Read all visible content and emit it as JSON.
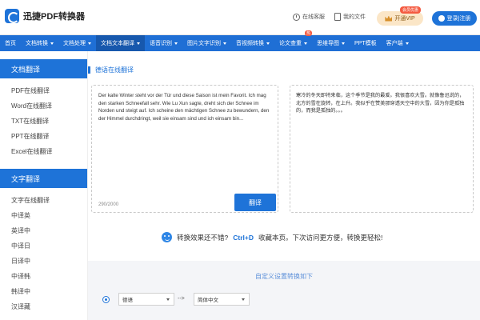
{
  "brand": {
    "name": "迅捷PDF转换器"
  },
  "topbar": {
    "online_service": "在线客服",
    "my_files": "我的文件",
    "vip": "开通VIP",
    "vip_badge": "会员优惠",
    "login": "登录|注册"
  },
  "nav": {
    "items": [
      {
        "label": "首页",
        "caret": false
      },
      {
        "label": "文档转换",
        "caret": true
      },
      {
        "label": "文档处理",
        "caret": true
      },
      {
        "label": "文档文本翻译",
        "caret": true,
        "active": true
      },
      {
        "label": "语音识别",
        "caret": true
      },
      {
        "label": "图片文字识别",
        "caret": true
      },
      {
        "label": "音视频转换",
        "caret": true
      },
      {
        "label": "论文查重",
        "caret": true,
        "badge": "热"
      },
      {
        "label": "思维导图",
        "caret": true
      },
      {
        "label": "PPT模板",
        "caret": false
      },
      {
        "label": "客户端",
        "caret": true
      }
    ]
  },
  "sidebar": {
    "doc_head": "文档翻译",
    "doc_items": [
      "PDF在线翻译",
      "Word在线翻译",
      "TXT在线翻译",
      "PPT在线翻译",
      "Excel在线翻译"
    ],
    "text_head": "文字翻译",
    "text_items": [
      "文字在线翻译",
      "中译英",
      "英译中",
      "中译日",
      "日译中",
      "中译韩",
      "韩译中",
      "汉译藏"
    ]
  },
  "main": {
    "section_title": "德语在线翻译",
    "source_text": "Der kalte Winter steht vor der Tür und diese Saison ist mein Favorit. Ich mag den starken Schneefall sehr. Wie Lu Xun sagte, dreht sich der Schnee im Norden und steigt auf. Ich scheine den mächtigen Schnee zu bewundern, den der Himmel durchdringt, weil sie einsam sind und ich einsam bin...",
    "char_count": "290/2000",
    "translate_button": "翻译",
    "target_text": "寒冷的冬天即将来临，这个季节是我的最爱。我很喜欢大雪。就像鲁迅说的，北方的雪在旋转，在上升。我似乎在赞美那穿透天空中的大雪，因为你是孤独的，而我是孤独的。。。",
    "tip_part1": "转换效果还不错?",
    "tip_shortcut": "Ctrl+D",
    "tip_part2": "收藏本页。下次访问更方便，转换更轻松!",
    "settings_title": "自定义设置转换如下",
    "from_lang": "德语",
    "arrow": "-->",
    "to_lang": "简体中文"
  },
  "colors": {
    "primary": "#1e73d8",
    "nav": "#1f6fd5",
    "nav_active": "#1758ad",
    "badge": "#f45b41",
    "vip_bg": "#fbe6c7"
  }
}
